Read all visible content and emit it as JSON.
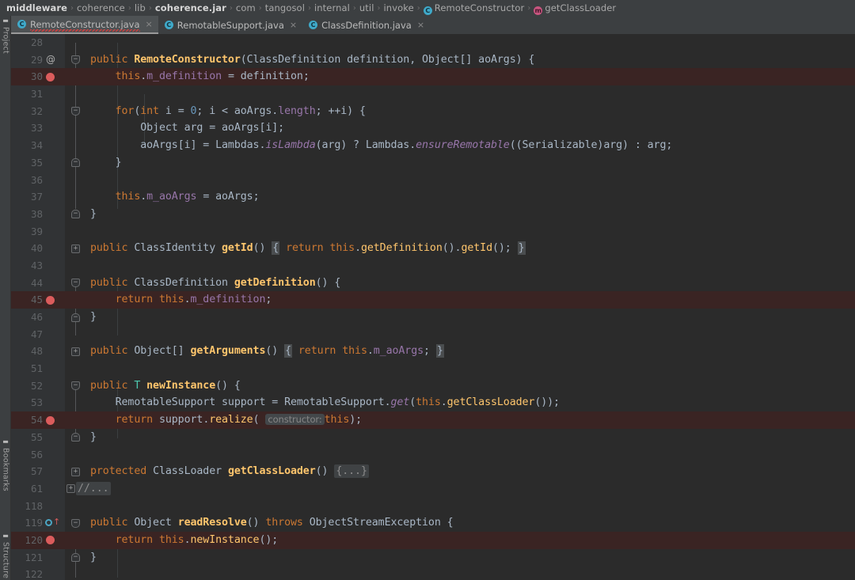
{
  "breadcrumb": {
    "items": [
      {
        "label": "middleware",
        "bold": true,
        "icon": ""
      },
      {
        "label": "coherence",
        "bold": false,
        "icon": ""
      },
      {
        "label": "lib",
        "bold": false,
        "icon": ""
      },
      {
        "label": "coherence.jar",
        "bold": true,
        "icon": ""
      },
      {
        "label": "com",
        "bold": false,
        "icon": ""
      },
      {
        "label": "tangosol",
        "bold": false,
        "icon": ""
      },
      {
        "label": "internal",
        "bold": false,
        "icon": ""
      },
      {
        "label": "util",
        "bold": false,
        "icon": ""
      },
      {
        "label": "invoke",
        "bold": false,
        "icon": ""
      },
      {
        "label": "RemoteConstructor",
        "bold": false,
        "icon": "class-icon"
      },
      {
        "label": "getClassLoader",
        "bold": false,
        "icon": "method-icon"
      }
    ],
    "separator": "›"
  },
  "toolwindows": {
    "project": "Project",
    "bookmarks": "Bookmarks",
    "structure": "Structure"
  },
  "tabs": [
    {
      "label": "RemoteConstructor.java",
      "icon": "C",
      "active": true,
      "error": true,
      "close": "×"
    },
    {
      "label": "RemotableSupport.java",
      "icon": "C",
      "active": false,
      "error": false,
      "close": "×"
    },
    {
      "label": "ClassDefinition.java",
      "icon": "C",
      "active": false,
      "error": false,
      "close": "×"
    }
  ],
  "colors": {
    "editor_background": "#2b2b2b",
    "gutter_background": "#313335",
    "chrome_background": "#3c3f41",
    "breakpoint_red": "#db5c5c",
    "breakpoint_row": "#3a2423",
    "keyword_orange": "#cc7832",
    "method_yellow": "#ffc66d",
    "field_purple": "#9876aa",
    "number_blue": "#6897bb",
    "text_default": "#a9b7c6",
    "type_param_teal": "#4ec9b0",
    "class_icon_cyan": "#3fa9c9",
    "method_icon_magenta": "#c9557f"
  },
  "editor": {
    "lines": [
      {
        "n": "28",
        "text": ""
      },
      {
        "n": "29",
        "text": "    public RemoteConstructor(ClassDefinition definition, Object[] aoArgs) {",
        "gutter": "annotation"
      },
      {
        "n": "30",
        "text": "        this.m_definition = definition;",
        "gutter": "breakpoint",
        "highlight": true
      },
      {
        "n": "31",
        "text": ""
      },
      {
        "n": "32",
        "text": "        for(int i = 0; i < aoArgs.length; ++i) {"
      },
      {
        "n": "33",
        "text": "            Object arg = aoArgs[i];"
      },
      {
        "n": "34",
        "text": "            aoArgs[i] = Lambdas.isLambda(arg) ? Lambdas.ensureRemotable((Serializable)arg) : arg;"
      },
      {
        "n": "35",
        "text": "        }"
      },
      {
        "n": "36",
        "text": ""
      },
      {
        "n": "37",
        "text": "        this.m_aoArgs = aoArgs;"
      },
      {
        "n": "38",
        "text": "    }"
      },
      {
        "n": "39",
        "text": ""
      },
      {
        "n": "40",
        "text": "    public ClassIdentity getId() { return this.getDefinition().getId(); }"
      },
      {
        "n": "43",
        "text": ""
      },
      {
        "n": "44",
        "text": "    public ClassDefinition getDefinition() {"
      },
      {
        "n": "45",
        "text": "        return this.m_definition;",
        "gutter": "breakpoint",
        "highlight": true
      },
      {
        "n": "46",
        "text": "    }"
      },
      {
        "n": "47",
        "text": ""
      },
      {
        "n": "48",
        "text": "    public Object[] getArguments() { return this.m_aoArgs; }"
      },
      {
        "n": "51",
        "text": ""
      },
      {
        "n": "52",
        "text": "    public T newInstance() {"
      },
      {
        "n": "53",
        "text": "        RemotableSupport support = RemotableSupport.get(this.getClassLoader());"
      },
      {
        "n": "54",
        "text": "        return support.realize( constructor: this);",
        "gutter": "breakpoint",
        "highlight": true
      },
      {
        "n": "55",
        "text": "    }"
      },
      {
        "n": "56",
        "text": ""
      },
      {
        "n": "57",
        "text": "    protected ClassLoader getClassLoader() {...}"
      },
      {
        "n": "61",
        "text": "//..."
      },
      {
        "n": "118",
        "text": ""
      },
      {
        "n": "119",
        "text": "    public Object readResolve() throws ObjectStreamException {",
        "gutter": "override"
      },
      {
        "n": "120",
        "text": "        return this.newInstance();",
        "gutter": "breakpoint",
        "highlight": true
      },
      {
        "n": "121",
        "text": "    }"
      },
      {
        "n": "122",
        "text": ""
      }
    ],
    "parameter_hint": "constructor:",
    "folded_body": "{...}",
    "folded_comment": "//..."
  }
}
